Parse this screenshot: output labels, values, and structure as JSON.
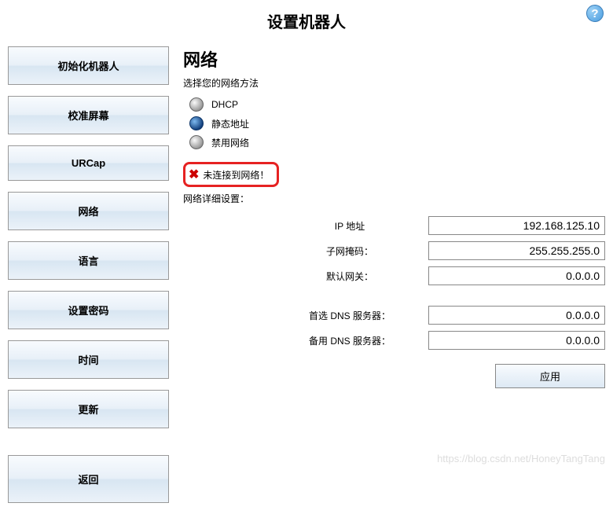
{
  "header": {
    "title": "设置机器人"
  },
  "sidebar": {
    "items": [
      {
        "label": "初始化机器人"
      },
      {
        "label": "校准屏幕"
      },
      {
        "label": "URCap"
      },
      {
        "label": "网络"
      },
      {
        "label": "语言"
      },
      {
        "label": "设置密码"
      },
      {
        "label": "时间"
      },
      {
        "label": "更新"
      }
    ],
    "back_label": "返回"
  },
  "main": {
    "title": "网络",
    "subtitle": "选择您的网络方法",
    "options": [
      {
        "label": "DHCP",
        "selected": false
      },
      {
        "label": "静态地址",
        "selected": true
      },
      {
        "label": "禁用网络",
        "selected": false
      }
    ],
    "status": "未连接到网络！",
    "details_title": "网络详细设置：",
    "fields": {
      "ip": {
        "label": "IP 地址",
        "value": "192.168.125.10"
      },
      "mask": {
        "label": "子网掩码：",
        "value": "255.255.255.0"
      },
      "gateway": {
        "label": "默认网关：",
        "value": "0.0.0.0"
      },
      "dns1": {
        "label": "首选 DNS 服务器：",
        "value": "0.0.0.0"
      },
      "dns2": {
        "label": "备用 DNS 服务器：",
        "value": "0.0.0.0"
      }
    },
    "apply_label": "应用"
  },
  "watermark": "https://blog.csdn.net/HoneyTangTang"
}
